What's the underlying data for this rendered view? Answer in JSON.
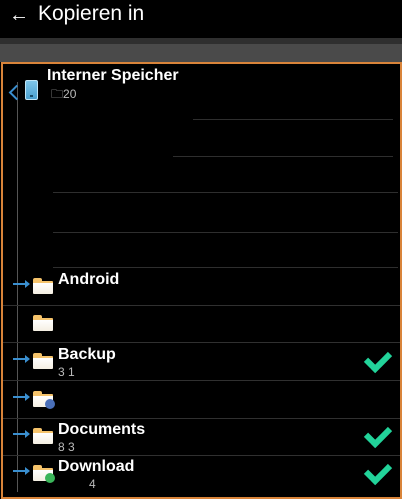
{
  "appbar": {
    "back_icon": "arrow-left-icon",
    "title": "Kopieren in"
  },
  "root": {
    "name": "Interner Speicher",
    "folder_count": "20",
    "icon": "phone-storage-icon"
  },
  "folders": [
    {
      "name": "Android",
      "meta": "",
      "checked": false
    },
    {
      "name": "",
      "meta": "",
      "checked": false
    },
    {
      "name": "Backup",
      "meta": "3  1",
      "checked": true
    },
    {
      "name": "",
      "meta": "",
      "checked": false
    },
    {
      "name": "Documents",
      "meta": "8  3",
      "checked": true
    },
    {
      "name": "Download",
      "meta": "4",
      "checked": true
    }
  ],
  "colors": {
    "accent_border": "#d9843a",
    "check": "#22d39a",
    "tree_arrow": "#3a8fd0"
  }
}
